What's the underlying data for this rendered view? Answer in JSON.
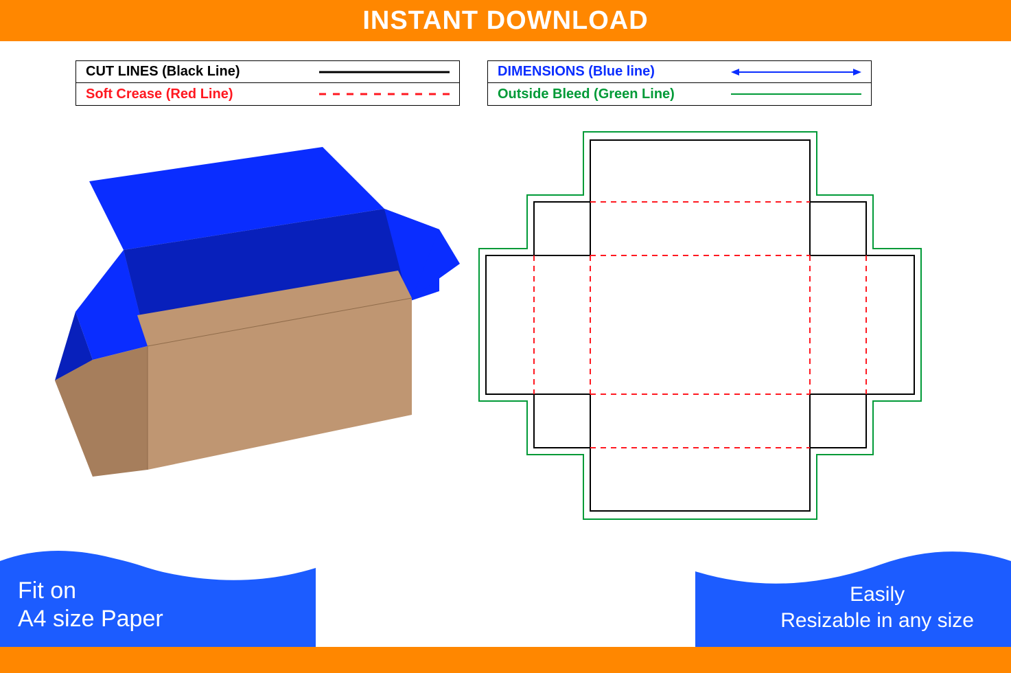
{
  "header": {
    "title": "INSTANT DOWNLOAD"
  },
  "legend": {
    "left": [
      {
        "label": "CUT LINES (Black Line)",
        "colorClass": "lbl-black"
      },
      {
        "label": "Soft Crease (Red Line)",
        "colorClass": "lbl-red"
      }
    ],
    "right": [
      {
        "label": "DIMENSIONS (Blue line)",
        "colorClass": "lbl-blue"
      },
      {
        "label": "Outside Bleed (Green Line)",
        "colorClass": "lbl-green"
      }
    ]
  },
  "bottomLeft": {
    "line1": "Fit on",
    "line2": "A4 size Paper"
  },
  "bottomRight": {
    "line1": "Easily",
    "line2": "Resizable in any size"
  },
  "colors": {
    "orange": "#ff8700",
    "blue": "#1c5cff",
    "boxBlue": "#0a2dff",
    "boxBlueDark": "#0820bb",
    "cardboard": "#bf9672",
    "cardboardDark": "#a67e5c",
    "red": "#ff1820",
    "green": "#009a37"
  }
}
